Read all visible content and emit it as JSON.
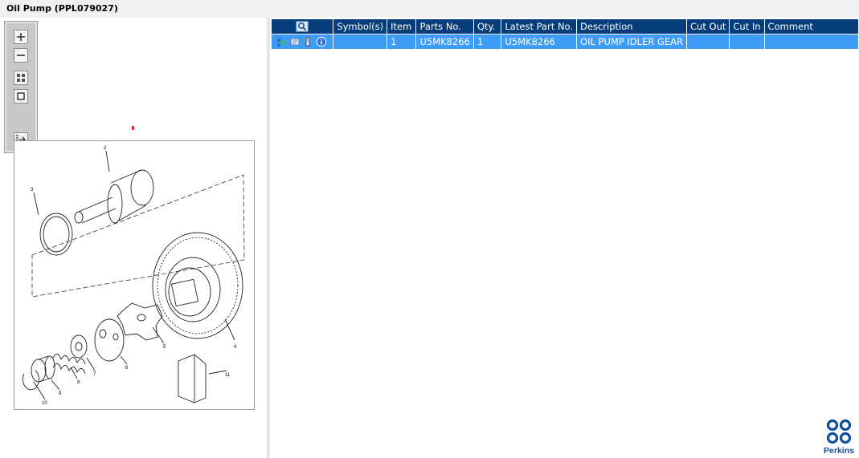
{
  "window": {
    "title": "Oil Pump (PPL079027)"
  },
  "toolbox": {
    "tools": [
      {
        "name": "zoom-in-icon"
      },
      {
        "name": "zoom-out-icon"
      },
      {
        "name": "fit-all-icon"
      },
      {
        "name": "fit-window-icon"
      },
      {
        "name": "export-icon"
      }
    ]
  },
  "drawing": {
    "callouts": [
      "2",
      "3",
      "4",
      "5",
      "6",
      "7",
      "8",
      "9",
      "10",
      "11"
    ]
  },
  "table": {
    "columns": [
      "",
      "Symbol(s)",
      "Item",
      "Parts No.",
      "Qty.",
      "Latest Part No.",
      "Description",
      "Cut Out",
      "Cut In",
      "Comment"
    ],
    "rows": [
      {
        "icons": [
          "part-link-icon",
          "note-icon",
          "attachment-icon",
          "info-icon"
        ],
        "symbols": "",
        "item": "1",
        "parts_no": "U5MK8266",
        "qty": "1",
        "latest_part_no": "U5MK8266",
        "description": "OIL PUMP IDLER GEAR",
        "cut_out": "",
        "cut_in": "",
        "comment": ""
      }
    ]
  },
  "brand": {
    "name": "Perkins",
    "color": "#10509a"
  },
  "colors": {
    "header": "#063d7a",
    "selected_row": "#3f9cf6",
    "marker": "#e03030"
  }
}
